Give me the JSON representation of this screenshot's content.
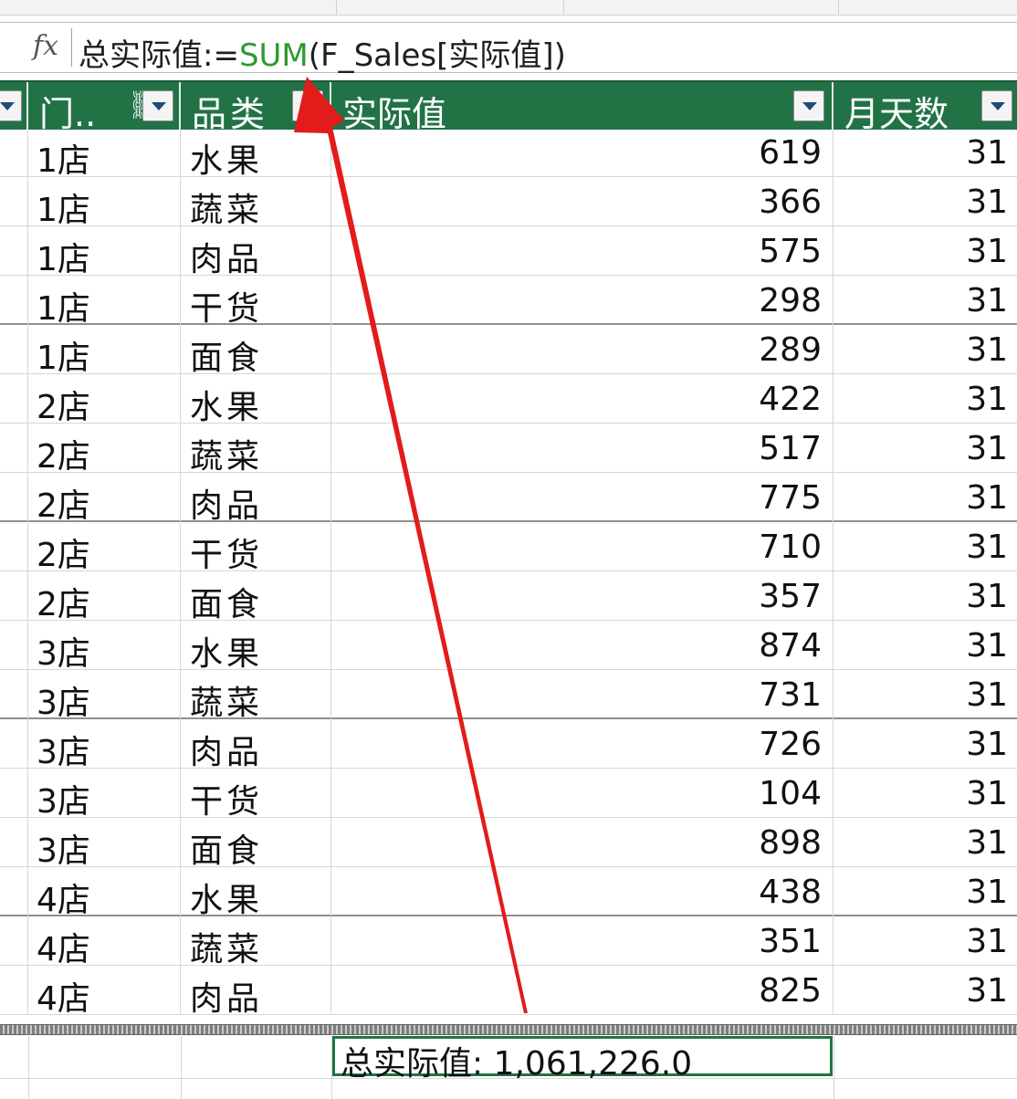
{
  "formula_bar": {
    "fx_icon": "fx",
    "measure_name": "总实际值",
    "assign_op": ":=",
    "function_name": "SUM",
    "open_paren": "(",
    "argument": "F_Sales[实际值]",
    "close_paren": ")"
  },
  "table": {
    "columns": [
      {
        "label": "门..",
        "has_relationship_icon": true
      },
      {
        "label": "品类"
      },
      {
        "label": "实际值"
      },
      {
        "label": "月天数"
      }
    ],
    "rows": [
      {
        "store": "1店",
        "category": "水果",
        "value": "619",
        "days": "31"
      },
      {
        "store": "1店",
        "category": "蔬菜",
        "value": "366",
        "days": "31"
      },
      {
        "store": "1店",
        "category": "肉品",
        "value": "575",
        "days": "31"
      },
      {
        "store": "1店",
        "category": "干货",
        "value": "298",
        "days": "31"
      },
      {
        "store": "1店",
        "category": "面食",
        "value": "289",
        "days": "31"
      },
      {
        "store": "2店",
        "category": "水果",
        "value": "422",
        "days": "31"
      },
      {
        "store": "2店",
        "category": "蔬菜",
        "value": "517",
        "days": "31"
      },
      {
        "store": "2店",
        "category": "肉品",
        "value": "775",
        "days": "31"
      },
      {
        "store": "2店",
        "category": "干货",
        "value": "710",
        "days": "31"
      },
      {
        "store": "2店",
        "category": "面食",
        "value": "357",
        "days": "31"
      },
      {
        "store": "3店",
        "category": "水果",
        "value": "874",
        "days": "31"
      },
      {
        "store": "3店",
        "category": "蔬菜",
        "value": "731",
        "days": "31"
      },
      {
        "store": "3店",
        "category": "肉品",
        "value": "726",
        "days": "31"
      },
      {
        "store": "3店",
        "category": "干货",
        "value": "104",
        "days": "31"
      },
      {
        "store": "3店",
        "category": "面食",
        "value": "898",
        "days": "31"
      },
      {
        "store": "4店",
        "category": "水果",
        "value": "438",
        "days": "31"
      },
      {
        "store": "4店",
        "category": "蔬菜",
        "value": "351",
        "days": "31"
      },
      {
        "store": "4店",
        "category": "肉品",
        "value": "825",
        "days": "31"
      }
    ]
  },
  "calculation_area": {
    "measure": "总实际值: 1,061,226.0"
  },
  "colors": {
    "header_green": "#217346",
    "function_green": "#2e9a2e",
    "arrow_red": "#e31b1b"
  }
}
